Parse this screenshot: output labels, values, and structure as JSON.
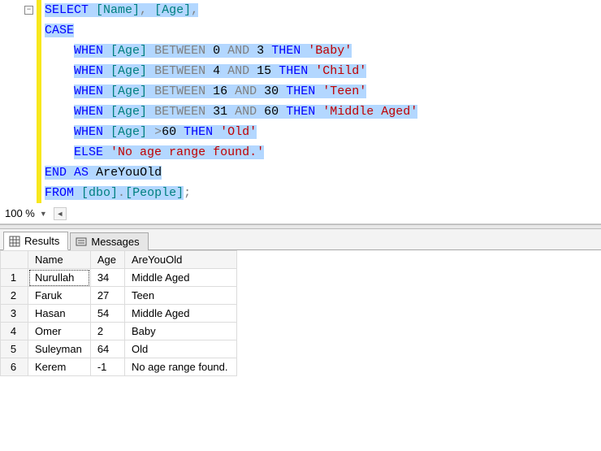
{
  "editor": {
    "tokens": [
      [
        {
          "t": "SELECT",
          "c": "kw-blue",
          "s": true
        },
        {
          "t": " ",
          "c": "",
          "s": true
        },
        {
          "t": "[Name]",
          "c": "kw-teal",
          "s": true
        },
        {
          "t": ", ",
          "c": "kw-gray",
          "s": true
        },
        {
          "t": "[Age]",
          "c": "kw-teal",
          "s": true
        },
        {
          "t": ",",
          "c": "kw-gray",
          "s": true
        }
      ],
      [
        {
          "t": "CASE",
          "c": "kw-blue",
          "s": true
        }
      ],
      [
        {
          "t": "    ",
          "c": "",
          "s": false
        },
        {
          "t": "WHEN",
          "c": "kw-blue",
          "s": true
        },
        {
          "t": " ",
          "c": "",
          "s": true
        },
        {
          "t": "[Age]",
          "c": "kw-teal",
          "s": true
        },
        {
          "t": " ",
          "c": "",
          "s": true
        },
        {
          "t": "BETWEEN",
          "c": "kw-gray",
          "s": true
        },
        {
          "t": " ",
          "c": "",
          "s": true
        },
        {
          "t": "0",
          "c": "num",
          "s": true
        },
        {
          "t": " ",
          "c": "",
          "s": true
        },
        {
          "t": "AND",
          "c": "kw-gray",
          "s": true
        },
        {
          "t": " ",
          "c": "",
          "s": true
        },
        {
          "t": "3",
          "c": "num",
          "s": true
        },
        {
          "t": " ",
          "c": "",
          "s": true
        },
        {
          "t": "THEN",
          "c": "kw-blue",
          "s": true
        },
        {
          "t": " ",
          "c": "",
          "s": true
        },
        {
          "t": "'Baby'",
          "c": "kw-red",
          "s": true
        }
      ],
      [
        {
          "t": "    ",
          "c": "",
          "s": false
        },
        {
          "t": "WHEN",
          "c": "kw-blue",
          "s": true
        },
        {
          "t": " ",
          "c": "",
          "s": true
        },
        {
          "t": "[Age]",
          "c": "kw-teal",
          "s": true
        },
        {
          "t": " ",
          "c": "",
          "s": true
        },
        {
          "t": "BETWEEN",
          "c": "kw-gray",
          "s": true
        },
        {
          "t": " ",
          "c": "",
          "s": true
        },
        {
          "t": "4",
          "c": "num",
          "s": true
        },
        {
          "t": " ",
          "c": "",
          "s": true
        },
        {
          "t": "AND",
          "c": "kw-gray",
          "s": true
        },
        {
          "t": " ",
          "c": "",
          "s": true
        },
        {
          "t": "15",
          "c": "num",
          "s": true
        },
        {
          "t": " ",
          "c": "",
          "s": true
        },
        {
          "t": "THEN",
          "c": "kw-blue",
          "s": true
        },
        {
          "t": " ",
          "c": "",
          "s": true
        },
        {
          "t": "'Child'",
          "c": "kw-red",
          "s": true
        }
      ],
      [
        {
          "t": "    ",
          "c": "",
          "s": false
        },
        {
          "t": "WHEN",
          "c": "kw-blue",
          "s": true
        },
        {
          "t": " ",
          "c": "",
          "s": true
        },
        {
          "t": "[Age]",
          "c": "kw-teal",
          "s": true
        },
        {
          "t": " ",
          "c": "",
          "s": true
        },
        {
          "t": "BETWEEN",
          "c": "kw-gray",
          "s": true
        },
        {
          "t": " ",
          "c": "",
          "s": true
        },
        {
          "t": "16",
          "c": "num",
          "s": true
        },
        {
          "t": " ",
          "c": "",
          "s": true
        },
        {
          "t": "AND",
          "c": "kw-gray",
          "s": true
        },
        {
          "t": " ",
          "c": "",
          "s": true
        },
        {
          "t": "30",
          "c": "num",
          "s": true
        },
        {
          "t": " ",
          "c": "",
          "s": true
        },
        {
          "t": "THEN",
          "c": "kw-blue",
          "s": true
        },
        {
          "t": " ",
          "c": "",
          "s": true
        },
        {
          "t": "'Teen'",
          "c": "kw-red",
          "s": true
        }
      ],
      [
        {
          "t": "    ",
          "c": "",
          "s": false
        },
        {
          "t": "WHEN",
          "c": "kw-blue",
          "s": true
        },
        {
          "t": " ",
          "c": "",
          "s": true
        },
        {
          "t": "[Age]",
          "c": "kw-teal",
          "s": true
        },
        {
          "t": " ",
          "c": "",
          "s": true
        },
        {
          "t": "BETWEEN",
          "c": "kw-gray",
          "s": true
        },
        {
          "t": " ",
          "c": "",
          "s": true
        },
        {
          "t": "31",
          "c": "num",
          "s": true
        },
        {
          "t": " ",
          "c": "",
          "s": true
        },
        {
          "t": "AND",
          "c": "kw-gray",
          "s": true
        },
        {
          "t": " ",
          "c": "",
          "s": true
        },
        {
          "t": "60",
          "c": "num",
          "s": true
        },
        {
          "t": " ",
          "c": "",
          "s": true
        },
        {
          "t": "THEN",
          "c": "kw-blue",
          "s": true
        },
        {
          "t": " ",
          "c": "",
          "s": true
        },
        {
          "t": "'Middle Aged'",
          "c": "kw-red",
          "s": true
        }
      ],
      [
        {
          "t": "    ",
          "c": "",
          "s": false
        },
        {
          "t": "WHEN",
          "c": "kw-blue",
          "s": true
        },
        {
          "t": " ",
          "c": "",
          "s": true
        },
        {
          "t": "[Age]",
          "c": "kw-teal",
          "s": true
        },
        {
          "t": " ",
          "c": "",
          "s": true
        },
        {
          "t": ">",
          "c": "kw-gray",
          "s": true
        },
        {
          "t": "60",
          "c": "num",
          "s": true
        },
        {
          "t": " ",
          "c": "",
          "s": true
        },
        {
          "t": "THEN",
          "c": "kw-blue",
          "s": true
        },
        {
          "t": " ",
          "c": "",
          "s": true
        },
        {
          "t": "'Old'",
          "c": "kw-red",
          "s": true
        }
      ],
      [
        {
          "t": "    ",
          "c": "",
          "s": false
        },
        {
          "t": "ELSE",
          "c": "kw-blue",
          "s": true
        },
        {
          "t": " ",
          "c": "",
          "s": true
        },
        {
          "t": "'No age range found.'",
          "c": "kw-red",
          "s": true
        }
      ],
      [
        {
          "t": "END",
          "c": "kw-blue",
          "s": true
        },
        {
          "t": " ",
          "c": "",
          "s": true
        },
        {
          "t": "AS",
          "c": "kw-blue",
          "s": true
        },
        {
          "t": " ",
          "c": "",
          "s": true
        },
        {
          "t": "AreYouOld",
          "c": "kw-black",
          "s": true
        }
      ],
      [
        {
          "t": "FROM",
          "c": "kw-blue",
          "s": true
        },
        {
          "t": " ",
          "c": "",
          "s": true
        },
        {
          "t": "[dbo]",
          "c": "kw-teal",
          "s": true
        },
        {
          "t": ".",
          "c": "kw-gray",
          "s": true
        },
        {
          "t": "[People]",
          "c": "kw-teal",
          "s": true
        },
        {
          "t": ";",
          "c": "kw-gray",
          "s": false
        }
      ]
    ]
  },
  "zoom": {
    "value": "100 %"
  },
  "tabs": {
    "results": "Results",
    "messages": "Messages"
  },
  "results": {
    "columns": [
      "Name",
      "Age",
      "AreYouOld"
    ],
    "rows": [
      {
        "n": "1",
        "Name": "Nurullah",
        "Age": "34",
        "AreYouOld": "Middle Aged"
      },
      {
        "n": "2",
        "Name": "Faruk",
        "Age": "27",
        "AreYouOld": "Teen"
      },
      {
        "n": "3",
        "Name": "Hasan",
        "Age": "54",
        "AreYouOld": "Middle Aged"
      },
      {
        "n": "4",
        "Name": "Omer",
        "Age": "2",
        "AreYouOld": "Baby"
      },
      {
        "n": "5",
        "Name": "Suleyman",
        "Age": "64",
        "AreYouOld": "Old"
      },
      {
        "n": "6",
        "Name": "Kerem",
        "Age": "-1",
        "AreYouOld": "No age range found."
      }
    ]
  }
}
